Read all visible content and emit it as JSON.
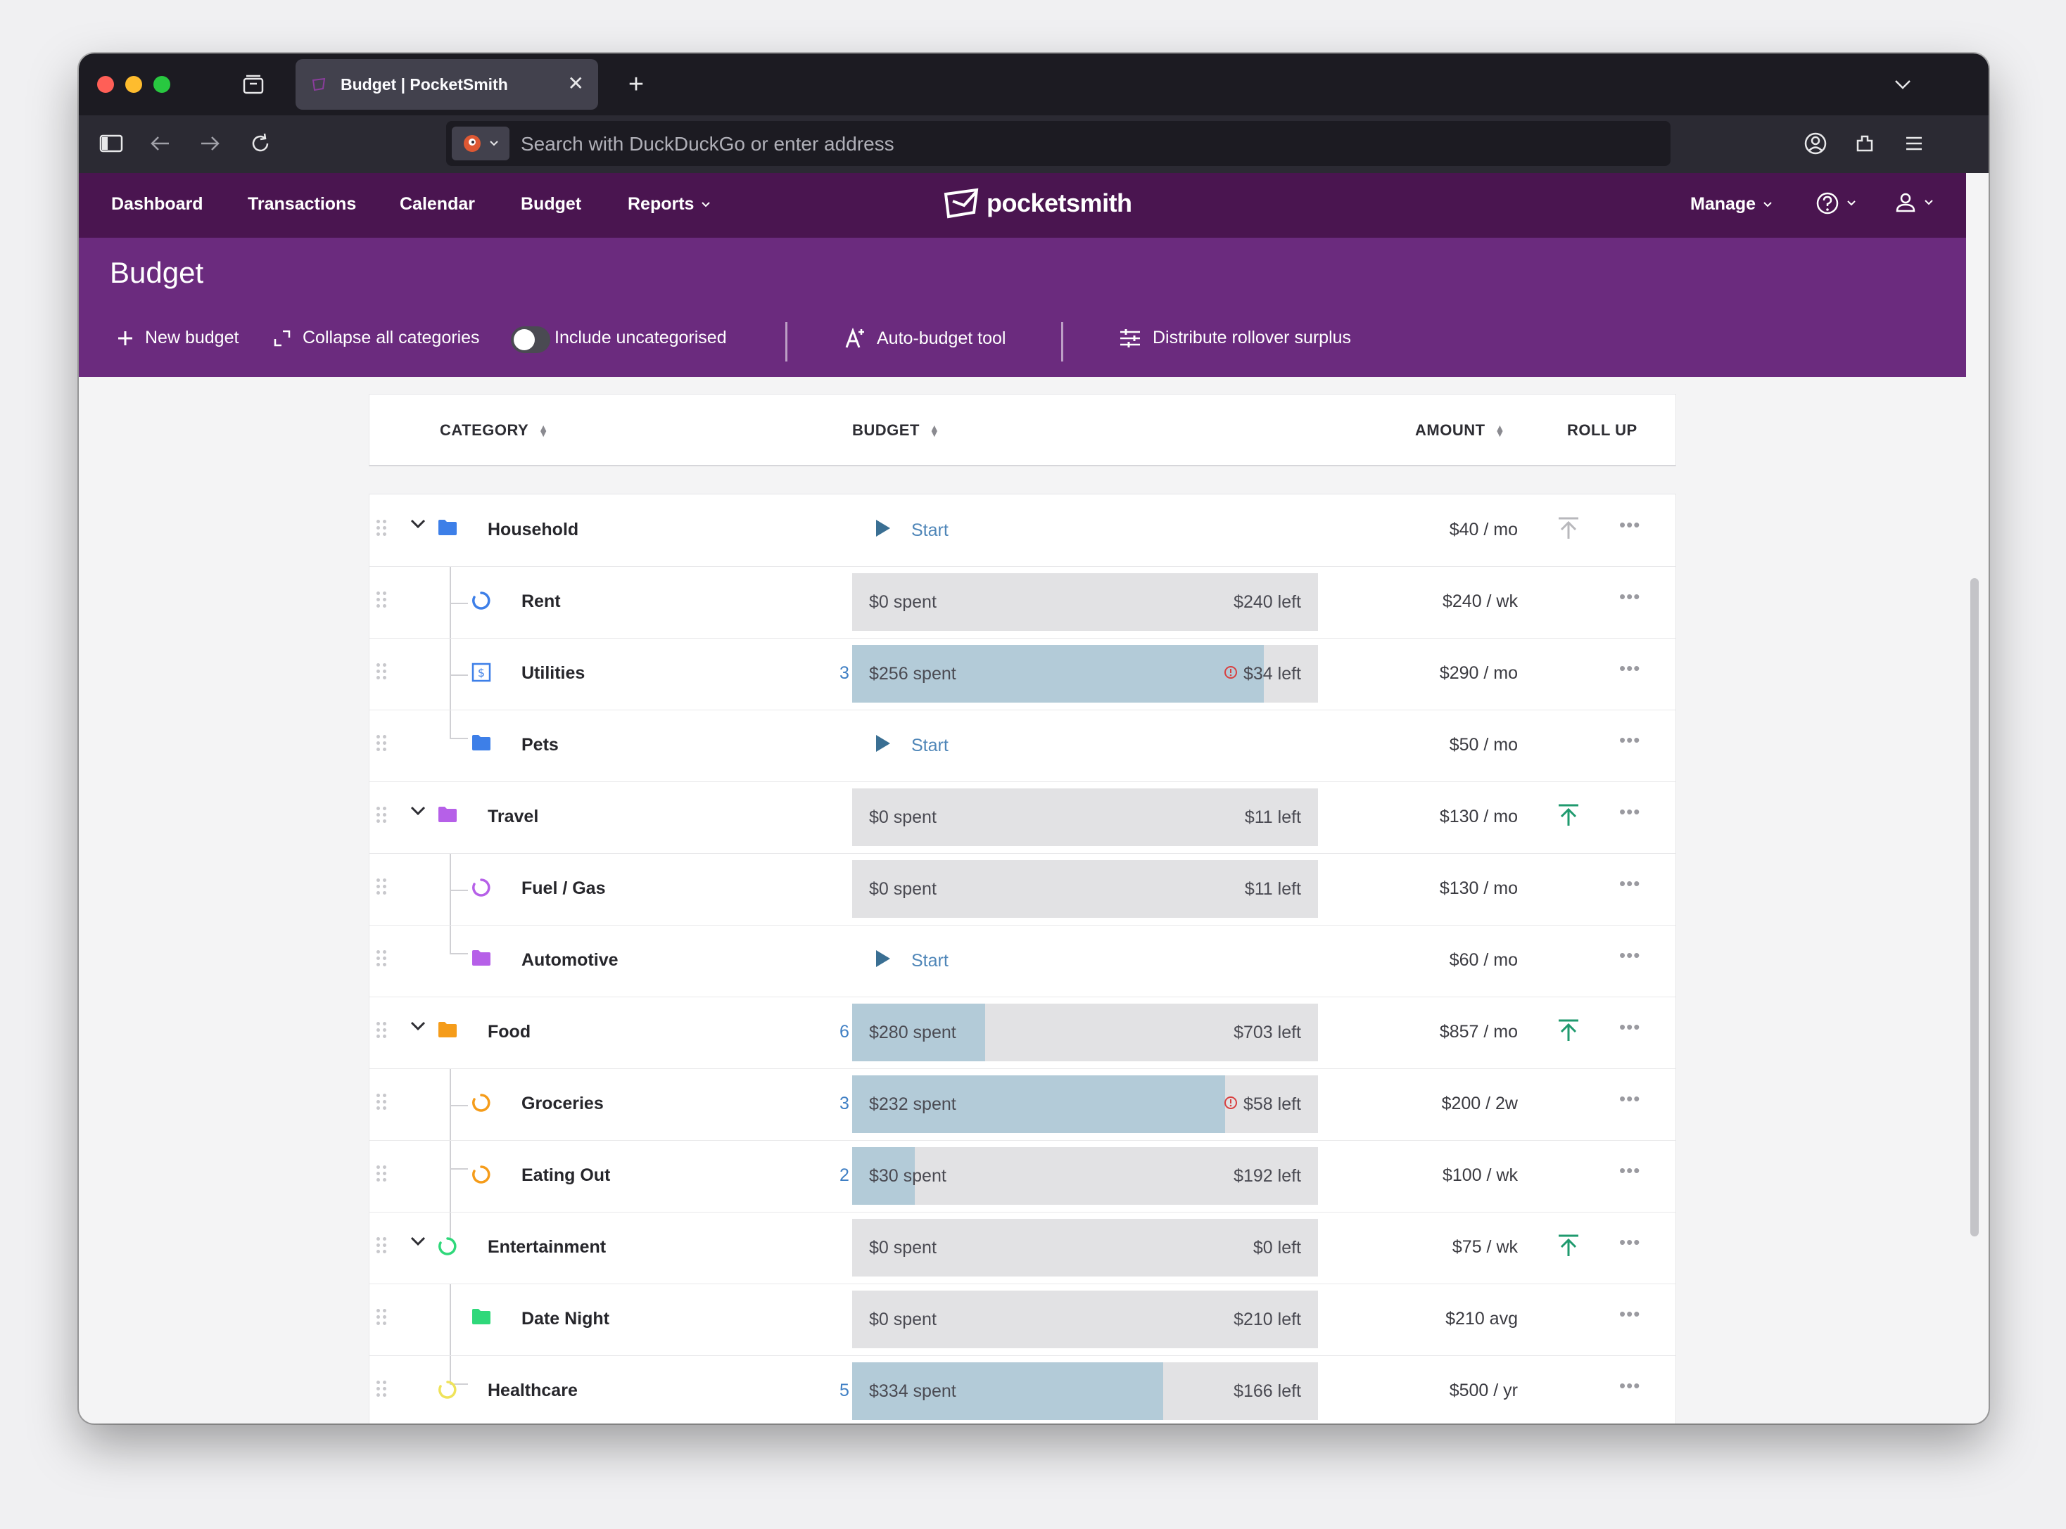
{
  "browser": {
    "tab_title": "Budget | PocketSmith",
    "url_placeholder": "Search with DuckDuckGo or enter address"
  },
  "app": {
    "nav": [
      "Dashboard",
      "Transactions",
      "Calendar",
      "Budget",
      "Reports"
    ],
    "logo_text": "pocketsmith",
    "manage_label": "Manage",
    "page_title": "Budget",
    "toolbar": {
      "new_budget": "New budget",
      "collapse": "Collapse all categories",
      "include_uncategorised": "Include uncategorised",
      "auto_budget": "Auto-budget tool",
      "distribute": "Distribute rollover surplus"
    },
    "colors": {
      "header_dark": "#4a1550",
      "header": "#6b2b7e",
      "fill": "#b3cbd8",
      "rollup_green": "#1f9a6e"
    }
  },
  "table": {
    "headers": {
      "category": "CATEGORY",
      "budget": "BUDGET",
      "amount": "AMOUNT",
      "rollup": "ROLL UP"
    },
    "rows": [
      {
        "name": "Household",
        "level": 0,
        "expander": true,
        "icon": "folder",
        "color": "#3d7fe8",
        "count": "",
        "bar": false,
        "start": "Start",
        "amount": "$40 / mo",
        "rollup": "grey"
      },
      {
        "name": "Rent",
        "level": 1,
        "icon": "ring",
        "color": "#3d7fe8",
        "count": "",
        "bar": true,
        "spent": "$0 spent",
        "left": "$240 left",
        "fill": 0,
        "warn": false,
        "amount": "$240 / wk",
        "rollup": ""
      },
      {
        "name": "Utilities",
        "level": 1,
        "icon": "bill",
        "color": "#3d7fe8",
        "count": "3",
        "bar": true,
        "spent": "$256 spent",
        "left": "$34 left",
        "fill": 0.883,
        "warn": true,
        "amount": "$290 / mo",
        "rollup": ""
      },
      {
        "name": "Pets",
        "level": 1,
        "icon": "folder",
        "color": "#3d7fe8",
        "count": "",
        "bar": false,
        "start": "Start",
        "amount": "$50 / mo",
        "rollup": ""
      },
      {
        "name": "Travel",
        "level": 0,
        "expander": true,
        "icon": "folder",
        "color": "#b660e8",
        "count": "",
        "bar": true,
        "spent": "$0 spent",
        "left": "$11 left",
        "fill": 0,
        "warn": false,
        "amount": "$130 / mo",
        "rollup": "green"
      },
      {
        "name": "Fuel / Gas",
        "level": 1,
        "icon": "ring",
        "color": "#b660e8",
        "count": "",
        "bar": true,
        "spent": "$0 spent",
        "left": "$11 left",
        "fill": 0,
        "warn": false,
        "amount": "$130 / mo",
        "rollup": ""
      },
      {
        "name": "Automotive",
        "level": 1,
        "icon": "folder",
        "color": "#b660e8",
        "count": "",
        "bar": false,
        "start": "Start",
        "amount": "$60 / mo",
        "rollup": ""
      },
      {
        "name": "Food",
        "level": 0,
        "expander": true,
        "icon": "folder",
        "color": "#f59c1a",
        "count": "6",
        "bar": true,
        "spent": "$280 spent",
        "left": "$703 left",
        "fill": 0.285,
        "warn": false,
        "amount": "$857 / mo",
        "rollup": "green"
      },
      {
        "name": "Groceries",
        "level": 1,
        "icon": "ring",
        "color": "#f59c1a",
        "count": "3",
        "bar": true,
        "spent": "$232 spent",
        "left": "$58 left",
        "fill": 0.8,
        "warn": true,
        "amount": "$200 / 2w",
        "rollup": ""
      },
      {
        "name": "Eating Out",
        "level": 1,
        "icon": "ring",
        "color": "#f59c1a",
        "count": "2",
        "bar": true,
        "spent": "$30 spent",
        "left": "$192 left",
        "fill": 0.135,
        "warn": false,
        "amount": "$100 / wk",
        "rollup": ""
      },
      {
        "name": "Entertainment",
        "level": 0,
        "expander": true,
        "icon": "ring",
        "color": "#2fd87a",
        "count": "",
        "bar": true,
        "spent": "$0 spent",
        "left": "$0 left",
        "fill": 0,
        "warn": false,
        "amount": "$75 / wk",
        "rollup": "green"
      },
      {
        "name": "Date Night",
        "level": 1,
        "icon": "folder",
        "color": "#2fd87a",
        "count": "",
        "bar": true,
        "spent": "$0 spent",
        "left": "$210 left",
        "fill": 0,
        "warn": false,
        "amount": "$210 avg",
        "rollup": ""
      },
      {
        "name": "Healthcare",
        "level": 0,
        "expander": false,
        "icon": "ring",
        "color": "#efe35a",
        "count": "5",
        "bar": true,
        "spent": "$334 spent",
        "left": "$166 left",
        "fill": 0.668,
        "warn": false,
        "amount": "$500 / yr",
        "rollup": ""
      }
    ]
  }
}
